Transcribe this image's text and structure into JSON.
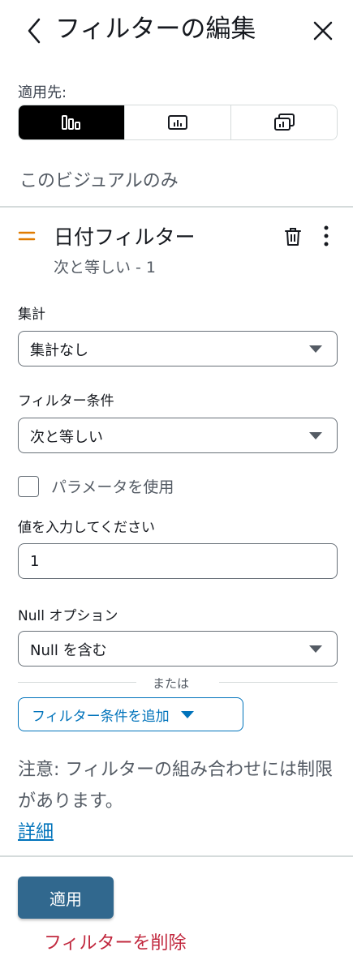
{
  "header": {
    "title": "フィルターの編集"
  },
  "applies_to": {
    "label": "適用先:",
    "options": [
      {
        "icon": "bar-chart-icon",
        "selected": true
      },
      {
        "icon": "visual-icon",
        "selected": false
      },
      {
        "icon": "multiple-visuals-icon",
        "selected": false
      }
    ],
    "scope_text": "このビジュアルのみ"
  },
  "filter": {
    "name": "日付フィルター",
    "summary": "次と等しい - 1"
  },
  "aggregation": {
    "label": "集計",
    "value": "集計なし"
  },
  "condition": {
    "label": "フィルター条件",
    "value": "次と等しい"
  },
  "parameter": {
    "label": "パラメータを使用",
    "checked": false
  },
  "value_input": {
    "label": "値を入力してください",
    "value": "1"
  },
  "null_option": {
    "label": "Null オプション",
    "value": "Null を含む"
  },
  "or_separator": "または",
  "add_condition_label": "フィルター条件を追加",
  "note": {
    "text": "注意: フィルターの組み合わせには制限があります。",
    "link": "詳細"
  },
  "footer": {
    "apply_label": "適用",
    "delete_label": "フィルターを削除"
  },
  "colors": {
    "primary": "#31688e",
    "link": "#0073bb",
    "danger": "#c1283e",
    "filter_accent": "#e07b00"
  }
}
